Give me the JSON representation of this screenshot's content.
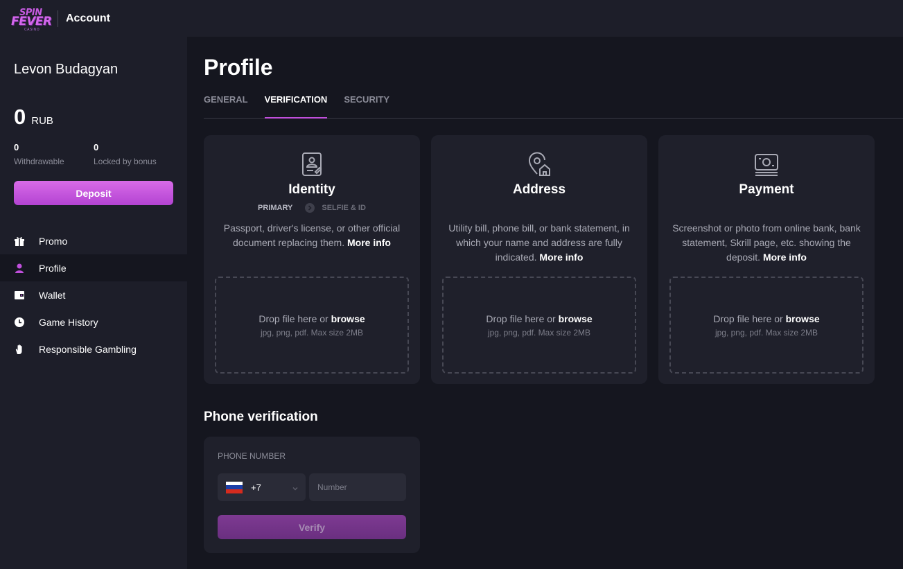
{
  "header": {
    "logo": {
      "line1": "SPIN",
      "line2": "FEVER",
      "line3": "CASINO"
    },
    "title": "Account"
  },
  "sidebar": {
    "user_name": "Levon Budagyan",
    "balance": {
      "value": "0",
      "currency": "RUB"
    },
    "stats": [
      {
        "value": "0",
        "label": "Withdrawable"
      },
      {
        "value": "0",
        "label": "Locked by bonus"
      }
    ],
    "deposit_label": "Deposit",
    "nav": [
      {
        "label": "Promo",
        "icon": "gift-icon",
        "active": false
      },
      {
        "label": "Profile",
        "icon": "user-icon",
        "active": true
      },
      {
        "label": "Wallet",
        "icon": "wallet-icon",
        "active": false
      },
      {
        "label": "Game History",
        "icon": "clock-icon",
        "active": false
      },
      {
        "label": "Responsible Gambling",
        "icon": "hand-icon",
        "active": false
      }
    ]
  },
  "main": {
    "title": "Profile",
    "tabs": [
      {
        "label": "GENERAL",
        "active": false
      },
      {
        "label": "VERIFICATION",
        "active": true
      },
      {
        "label": "SECURITY",
        "active": false
      }
    ],
    "cards": [
      {
        "title": "Identity",
        "icon": "id-card-icon",
        "steps": {
          "primary": "PRIMARY",
          "secondary": "SELFIE & ID"
        },
        "description": "Passport, driver's license, or other official document replacing them.",
        "more_info": "More info",
        "drop_text": "Drop file here or",
        "browse": "browse",
        "hint": "jpg, png, pdf. Max size 2MB"
      },
      {
        "title": "Address",
        "icon": "location-home-icon",
        "description": "Utility bill, phone bill, or bank statement, in which your name and address are fully indicated.",
        "more_info": "More info",
        "drop_text": "Drop file here or",
        "browse": "browse",
        "hint": "jpg, png, pdf. Max size 2MB"
      },
      {
        "title": "Payment",
        "icon": "payment-icon",
        "description": "Screenshot or photo from online bank, bank statement, Skrill page, etc. showing the deposit.",
        "more_info": "More info",
        "drop_text": "Drop file here or",
        "browse": "browse",
        "hint": "jpg, png, pdf. Max size 2MB"
      }
    ],
    "phone": {
      "section_title": "Phone verification",
      "label": "PHONE NUMBER",
      "dial_code": "+7",
      "number_placeholder": "Number",
      "verify_label": "Verify"
    }
  },
  "colors": {
    "accent": "#c04fdc",
    "background": "#15161f",
    "panel": "#1d1e29",
    "card": "#1f202b"
  }
}
